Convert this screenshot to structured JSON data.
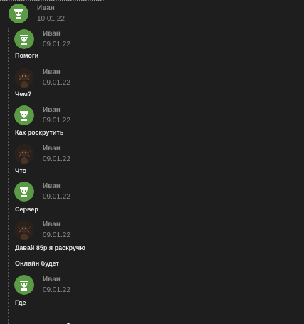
{
  "root_post": {
    "author": "Иван",
    "date": "10.01.22",
    "avatar": "green-mask-icon"
  },
  "replies": [
    {
      "author": "Иван",
      "date": "09.01.22",
      "avatar": "green-mask-icon",
      "text": "Помоги"
    },
    {
      "author": "Иван",
      "date": "09.01.22",
      "avatar": "dark-character-icon",
      "text": "Чем?"
    },
    {
      "author": "Иван",
      "date": "09.01.22",
      "avatar": "green-mask-icon",
      "text": "Как роскрутить"
    },
    {
      "author": "Иван",
      "date": "09.01.22",
      "avatar": "dark-character-icon",
      "text": "Что"
    },
    {
      "author": "Иван",
      "date": "09.01.22",
      "avatar": "green-mask-icon",
      "text": "Сервер"
    },
    {
      "author": "Иван",
      "date": "09.01.22",
      "avatar": "dark-character-icon",
      "text": "Давай 85р я раскручю",
      "text2": "Онлайн будет"
    },
    {
      "author": "Иван",
      "date": "09.01.22",
      "avatar": "green-mask-icon",
      "text": "Где"
    }
  ],
  "colors": {
    "background": "#1e1e1e",
    "avatar_green": "#5b9b46",
    "meta_text": "#8a8a8a",
    "message_text": "#e6e6e6"
  }
}
